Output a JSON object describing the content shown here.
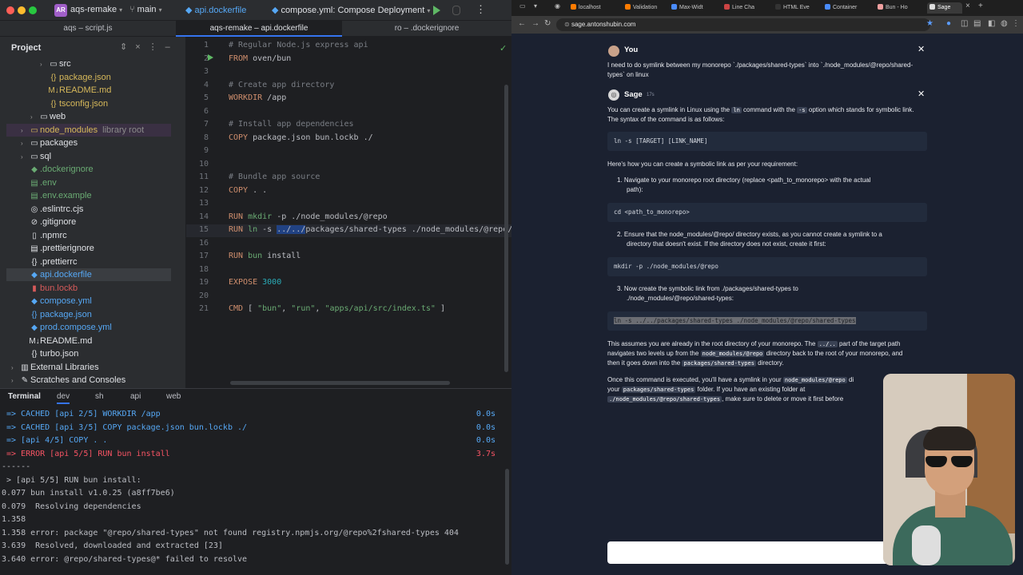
{
  "ide": {
    "project_badge": "AR",
    "project_name": "aqs-remake",
    "branch": "main",
    "file_title": "api.dockerfile",
    "run_config": "compose.yml: Compose Deployment",
    "tabs": [
      {
        "label": "aqs – script.js"
      },
      {
        "label": "aqs-remake – api.dockerfile"
      },
      {
        "label": "ro – .dockerignore"
      }
    ],
    "project_panel_title": "Project",
    "tree": [
      {
        "name": "src",
        "color": "#dfe1e5",
        "icon": "folder-icon",
        "glyph": "▭",
        "arrow": "›",
        "level": 3
      },
      {
        "name": "package.json",
        "color": "#d6b85a",
        "icon": "json-icon",
        "glyph": "{}",
        "arrow": "",
        "level": 3
      },
      {
        "name": "README.md",
        "color": "#d6b85a",
        "icon": "markdown-icon",
        "glyph": "M↓",
        "arrow": "",
        "level": 3
      },
      {
        "name": "tsconfig.json",
        "color": "#d6b85a",
        "icon": "json-icon",
        "glyph": "{}",
        "arrow": "",
        "level": 3
      },
      {
        "name": "web",
        "color": "#dfe1e5",
        "icon": "folder-icon",
        "glyph": "▭",
        "arrow": "›",
        "level": 2
      },
      {
        "name": "node_modules",
        "extra": "library root",
        "color": "#d6b85a",
        "icon": "folder-icon",
        "glyph": "▭",
        "arrow": "›",
        "level": 1
      },
      {
        "name": "packages",
        "color": "#dfe1e5",
        "icon": "folder-icon",
        "glyph": "▭",
        "arrow": "›",
        "level": 1
      },
      {
        "name": "sql",
        "color": "#dfe1e5",
        "icon": "folder-icon",
        "glyph": "▭",
        "arrow": "›",
        "level": 1
      },
      {
        "name": ".dockerignore",
        "color": "#6aab73",
        "icon": "docker-icon",
        "glyph": "◆",
        "arrow": "",
        "level": 1
      },
      {
        "name": ".env",
        "color": "#6aab73",
        "icon": "env-icon",
        "glyph": "▤",
        "arrow": "",
        "level": 1
      },
      {
        "name": ".env.example",
        "color": "#6aab73",
        "icon": "env-icon",
        "glyph": "▤",
        "arrow": "",
        "level": 1
      },
      {
        "name": ".eslintrc.cjs",
        "color": "#dfe1e5",
        "icon": "eslint-icon",
        "glyph": "◎",
        "arrow": "",
        "level": 1
      },
      {
        "name": ".gitignore",
        "color": "#dfe1e5",
        "icon": "gitignore-icon",
        "glyph": "⊘",
        "arrow": "",
        "level": 1
      },
      {
        "name": ".npmrc",
        "color": "#dfe1e5",
        "icon": "file-icon",
        "glyph": "▯",
        "arrow": "",
        "level": 1
      },
      {
        "name": ".prettierignore",
        "color": "#dfe1e5",
        "icon": "prettier-icon",
        "glyph": "▤",
        "arrow": "",
        "level": 1
      },
      {
        "name": ".prettierrc",
        "color": "#dfe1e5",
        "icon": "json-icon",
        "glyph": "{}",
        "arrow": "",
        "level": 1
      },
      {
        "name": "api.dockerfile",
        "color": "#56a8f5",
        "icon": "docker-icon",
        "glyph": "◆",
        "arrow": "",
        "level": 1
      },
      {
        "name": "bun.lockb",
        "color": "#d65a5a",
        "icon": "lock-file-icon",
        "glyph": "▮",
        "arrow": "",
        "level": 1
      },
      {
        "name": "compose.yml",
        "color": "#56a8f5",
        "icon": "yaml-icon",
        "glyph": "◆",
        "arrow": "",
        "level": 1
      },
      {
        "name": "package.json",
        "color": "#56a8f5",
        "icon": "json-icon",
        "glyph": "{}",
        "arrow": "",
        "level": 1
      },
      {
        "name": "prod.compose.yml",
        "color": "#56a8f5",
        "icon": "yaml-icon",
        "glyph": "◆",
        "arrow": "",
        "level": 1
      },
      {
        "name": "README.md",
        "color": "#dfe1e5",
        "icon": "markdown-icon",
        "glyph": "M↓",
        "arrow": "",
        "level": 1
      },
      {
        "name": "turbo.json",
        "color": "#dfe1e5",
        "icon": "json-icon",
        "glyph": "{}",
        "arrow": "",
        "level": 1
      },
      {
        "name": "External Libraries",
        "color": "#dfe1e5",
        "icon": "library-icon",
        "glyph": "▥",
        "arrow": "›",
        "level": 0
      },
      {
        "name": "Scratches and Consoles",
        "color": "#dfe1e5",
        "icon": "scratch-icon",
        "glyph": "✎",
        "arrow": "›",
        "level": 0
      }
    ],
    "code_lines": [
      {
        "n": "1",
        "text": "# Regular Node.js express api",
        "style": "comment"
      },
      {
        "n": "2",
        "text": "FROM oven/bun",
        "style": "kw"
      },
      {
        "n": "3",
        "text": "",
        "style": ""
      },
      {
        "n": "4",
        "text": "# Create app directory",
        "style": "comment"
      },
      {
        "n": "5",
        "text": "WORKDIR /app",
        "style": "kw"
      },
      {
        "n": "6",
        "text": "",
        "style": ""
      },
      {
        "n": "7",
        "text": "# Install app dependencies",
        "style": "comment"
      },
      {
        "n": "8",
        "text": "COPY package.json bun.lockb ./",
        "style": "kw"
      },
      {
        "n": "9",
        "text": "",
        "style": ""
      },
      {
        "n": "10",
        "text": "",
        "style": ""
      },
      {
        "n": "11",
        "text": "# Bundle app source",
        "style": "comment"
      },
      {
        "n": "12",
        "text": "COPY . .",
        "style": "kw"
      },
      {
        "n": "13",
        "text": "",
        "style": ""
      },
      {
        "n": "14",
        "text": "RUN mkdir -p ./node_modules/@repo",
        "style": "run"
      },
      {
        "n": "15",
        "text": "RUN ln -s ../../packages/shared-types ./node_modules/@repo/",
        "style": "run-hl"
      },
      {
        "n": "16",
        "text": "",
        "style": ""
      },
      {
        "n": "17",
        "text": "RUN bun install",
        "style": "run"
      },
      {
        "n": "18",
        "text": "",
        "style": ""
      },
      {
        "n": "19",
        "text": "EXPOSE 3000",
        "style": "expose"
      },
      {
        "n": "20",
        "text": "",
        "style": ""
      },
      {
        "n": "21",
        "text": "CMD [ \"bun\", \"run\", \"apps/api/src/index.ts\" ]",
        "style": "cmd"
      }
    ],
    "terminal": {
      "title": "Terminal",
      "tabs": [
        "dev",
        "sh",
        "api",
        "web"
      ],
      "lines": [
        {
          "text": "=> CACHED [api 2/5] WORKDIR /app",
          "time": "0.0s",
          "color": "#56a8f5"
        },
        {
          "text": "=> CACHED [api 3/5] COPY package.json bun.lockb ./",
          "time": "0.0s",
          "color": "#56a8f5"
        },
        {
          "text": "=> [api 4/5] COPY . .",
          "time": "0.0s",
          "color": "#56a8f5"
        },
        {
          "text": "=> ERROR [api 5/5] RUN bun install",
          "time": "3.7s",
          "color": "#f75464"
        },
        {
          "text": "------",
          "time": "",
          "color": "#bcbec4"
        },
        {
          "text": " > [api 5/5] RUN bun install:",
          "time": "",
          "color": "#bcbec4"
        },
        {
          "text": "0.077 bun install v1.0.25 (a8ff7be6)",
          "time": "",
          "color": "#bcbec4"
        },
        {
          "text": "0.079  Resolving dependencies",
          "time": "",
          "color": "#bcbec4"
        },
        {
          "text": "1.358",
          "time": "",
          "color": "#bcbec4"
        },
        {
          "text": "1.358 error: package \"@repo/shared-types\" not found registry.npmjs.org/@repo%2fshared-types 404",
          "time": "",
          "color": "#bcbec4"
        },
        {
          "text": "3.639  Resolved, downloaded and extracted [23]",
          "time": "",
          "color": "#bcbec4"
        },
        {
          "text": "3.640 error: @repo/shared-types@* failed to resolve",
          "time": "",
          "color": "#bcbec4"
        }
      ]
    }
  },
  "browser": {
    "tabs": [
      {
        "label": "localhost",
        "color": "#ff7b00"
      },
      {
        "label": "Validation",
        "color": "#ff7b00"
      },
      {
        "label": "Max-Widt",
        "color": "#4a8cff"
      },
      {
        "label": "Line Cha",
        "color": "#cc4444"
      },
      {
        "label": "HTML Eve",
        "color": "#333333"
      },
      {
        "label": "Container",
        "color": "#4a8cff"
      },
      {
        "label": "Bun - Ho",
        "color": "#f0a0a0"
      },
      {
        "label": "Sage",
        "color": "#dddddd"
      }
    ],
    "url": "sage.antonshubin.com",
    "chat": {
      "user_name": "You",
      "user_msg_1": "I need to do symlink between my monorepo `./packages/shared-types` into `./node_modules/@repo/shared-",
      "user_msg_2": "types` on linux",
      "sage_name": "Sage",
      "sage_time": "17s",
      "p1a": "You can create a symlink in Linux using the",
      "p1_code1": "ln",
      "p1b": "command with the",
      "p1_code2": "-s",
      "p1c": "option which stands for symbolic link.",
      "p1_line2": "The syntax of the command is as follows:",
      "code1": "ln -s [TARGET] [LINK_NAME]",
      "p2": "Here's how you can create a symbolic link as per your requirement:",
      "step1a": "1.  Navigate to your monorepo root directory (replace <path_to_monorepo> with the actual",
      "step1b": "path):",
      "code2": "cd <path_to_monorepo>",
      "step2a": "2.  Ensure that the node_modules/@repo/ directory exists, as you cannot create a symlink to a",
      "step2b": "directory that doesn't exist. If the directory does not exist, create it first:",
      "code3": "mkdir -p ./node_modules/@repo",
      "step3a": "3.  Now create the symbolic link from ./packages/shared-types to",
      "step3b": "./node_modules/@repo/shared-types:",
      "code4": "ln -s ../../packages/shared-types ./node_modules/@repo/shared-types",
      "p3a": "This assumes you are already in the root directory of your monorepo. The",
      "p3_code1": "../..",
      "p3b": "part of the target path",
      "p3c": "navigates two levels up from the",
      "p3_code2": "node_modules/@repo",
      "p3d": "directory back to the root of your monorepo, and",
      "p3e": "then it goes down into the",
      "p3_code3": "packages/shared-types",
      "p3f": "directory.",
      "p4a": "Once this command is executed, you'll have a symlink in your",
      "p4_code1": "node_modules/@repo",
      "p4b": "di",
      "p4c": "your",
      "p4_code2": "packages/shared-types",
      "p4d": "folder. If you have an existing folder at",
      "p4_code3": "./node_modules/@repo/shared-types",
      "p4e": ", make sure to delete or move it first before"
    }
  }
}
